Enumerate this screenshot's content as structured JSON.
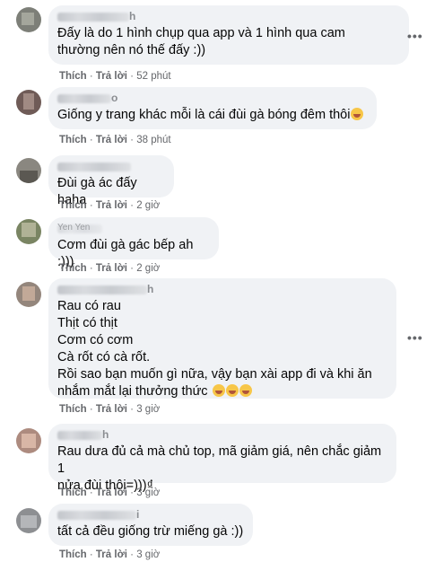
{
  "action_like": "Thích",
  "action_reply": "Trả lời",
  "separator": "·",
  "more": "•••",
  "comments": [
    {
      "name_tail": "h",
      "text": "Đấy là do 1 hình chụp qua app và 1 hình qua cam\nthường nên nó thế đấy :))",
      "time": "52 phút"
    },
    {
      "name_tail": "o",
      "text": "Giống y trang khác mỗi là cái đùi gà bóng đêm thôi",
      "time": "38 phút"
    },
    {
      "name_tail": "",
      "text": "Đùi gà ác đấy haha",
      "time": "2 giờ"
    },
    {
      "name_tail": "Yen Yen",
      "text": "Cơm đùi gà gác bếp ah :)))",
      "time": "2 giờ"
    },
    {
      "name_tail": "h",
      "text": "Rau có rau\nThịt có thịt\nCơm có cơm\nCà rốt có cà rốt.\nRồi sao bạn muốn gì nữa, vậy bạn xài app đi và khi ăn\nnhắm mắt lại thưởng thức",
      "time": "3 giờ"
    },
    {
      "name_tail": "h",
      "text": "Rau dưa đủ cả mà chủ top, mã giảm giá, nên chắc giảm 1\nnửa đùi thôi=)))₫",
      "time": "3 giờ"
    },
    {
      "name_tail": "i",
      "text": "tất cả đều giống trừ miếng gà :))",
      "time": "3 giờ"
    }
  ]
}
